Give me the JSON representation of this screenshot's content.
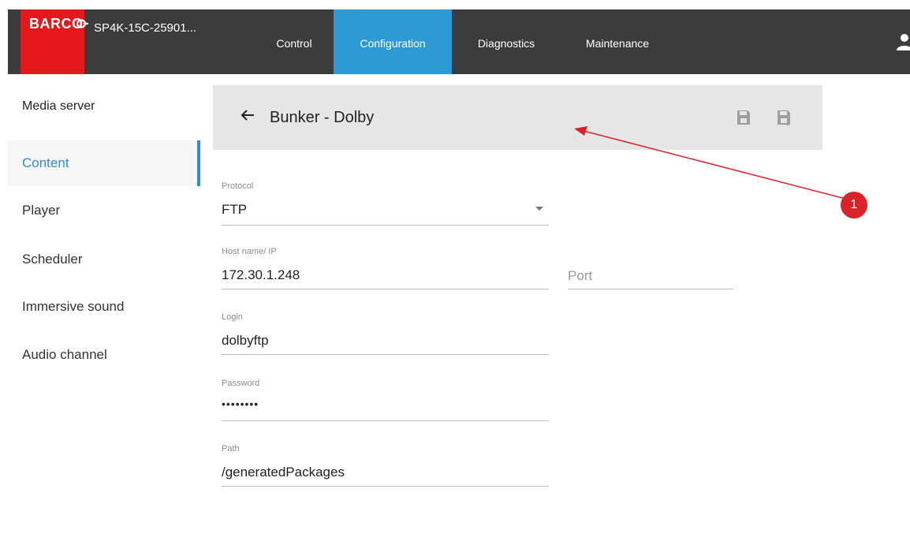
{
  "header": {
    "logo_text": "BARCO",
    "device_name": "SP4K-15C-25901...",
    "tabs": [
      {
        "label": "Control"
      },
      {
        "label": "Configuration"
      },
      {
        "label": "Diagnostics"
      },
      {
        "label": "Maintenance"
      }
    ],
    "active_tab": "Configuration"
  },
  "sidebar": {
    "title": "Media server",
    "items": [
      {
        "label": "Content"
      },
      {
        "label": "Player"
      },
      {
        "label": "Scheduler"
      },
      {
        "label": "Immersive sound"
      },
      {
        "label": "Audio channel"
      }
    ],
    "active_item": "Content"
  },
  "page": {
    "title": "Bunker - Dolby"
  },
  "form": {
    "protocol": {
      "label": "Protocol",
      "value": "FTP"
    },
    "host": {
      "label": "Host name/ IP",
      "value": "172.30.1.248"
    },
    "port": {
      "placeholder": "Port"
    },
    "login": {
      "label": "Login",
      "value": "dolbyftp"
    },
    "password": {
      "label": "Password",
      "value": "••••••••"
    },
    "path": {
      "label": "Path",
      "value": "/generatedPackages"
    }
  },
  "annotation": {
    "badge": "1",
    "color": "#d8232a"
  },
  "colors": {
    "topbar": "#3c3c3c",
    "accent": "#2d9ad6",
    "brand_red": "#e3191c"
  }
}
